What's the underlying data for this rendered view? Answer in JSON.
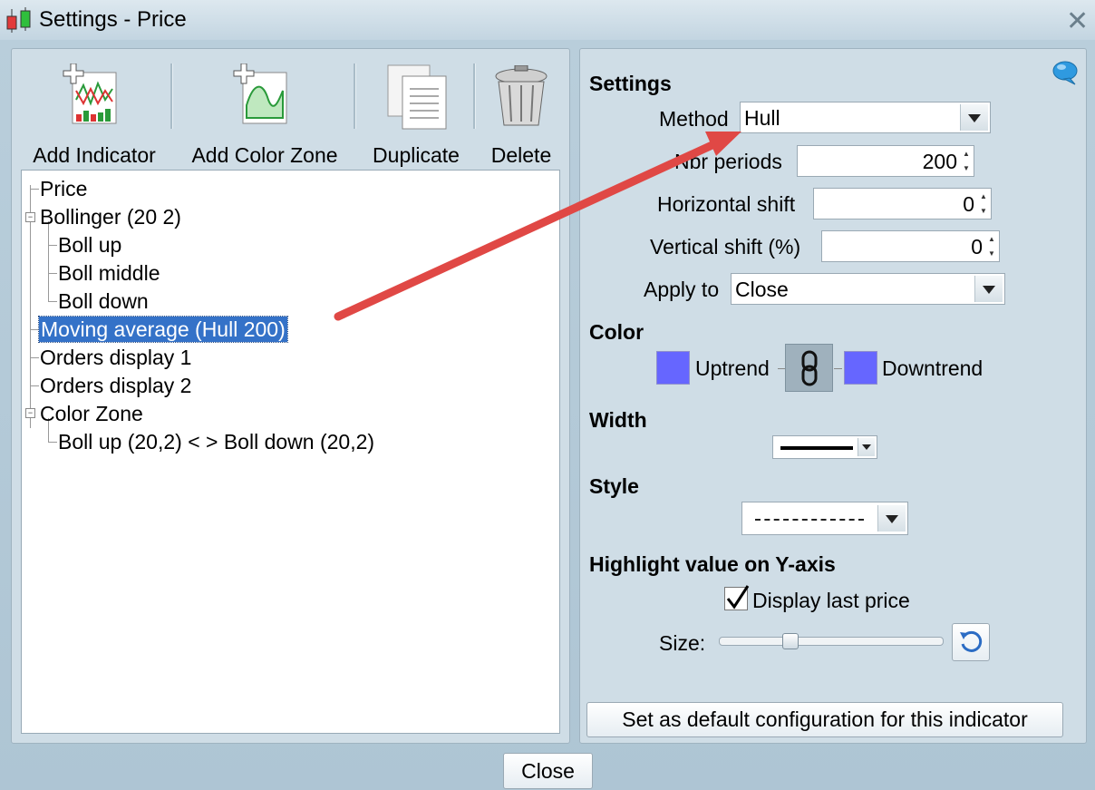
{
  "window": {
    "title": "Settings - Price",
    "close_glyph": "✕"
  },
  "toolbar": {
    "add_indicator": "Add Indicator",
    "add_color_zone": "Add Color Zone",
    "duplicate": "Duplicate",
    "delete": "Delete"
  },
  "tree": {
    "items": [
      {
        "label": "Price"
      },
      {
        "label": "Bollinger (20 2)"
      },
      {
        "label": "Boll up"
      },
      {
        "label": "Boll middle"
      },
      {
        "label": "Boll down"
      },
      {
        "label": "Moving average (Hull 200)",
        "selected": true
      },
      {
        "label": "Orders display 1"
      },
      {
        "label": "Orders display 2"
      },
      {
        "label": "Color Zone"
      },
      {
        "label": "Boll up (20,2) < > Boll down (20,2)"
      }
    ]
  },
  "settings": {
    "heading": "Settings",
    "method_label": "Method",
    "method_value": "Hull",
    "nbr_periods_label": "Nbr periods",
    "nbr_periods_value": "200",
    "hshift_label": "Horizontal shift",
    "hshift_value": "0",
    "vshift_label": "Vertical shift (%)",
    "vshift_value": "0",
    "apply_to_label": "Apply to",
    "apply_to_value": "Close"
  },
  "color": {
    "heading": "Color",
    "uptrend_label": "Uptrend",
    "downtrend_label": "Downtrend",
    "uptrend_color": "#6666ff",
    "downtrend_color": "#6666ff"
  },
  "width": {
    "heading": "Width"
  },
  "style": {
    "heading": "Style"
  },
  "highlight": {
    "heading": "Highlight value on Y-axis",
    "display_last_price_label": "Display last price",
    "display_last_price_checked": true,
    "size_label": "Size:",
    "size_level": 0.3
  },
  "footer": {
    "default_button": "Set as default configuration for this indicator",
    "close_button": "Close"
  },
  "colors": {
    "selection": "#3472c8",
    "arrow": "#e04845"
  }
}
